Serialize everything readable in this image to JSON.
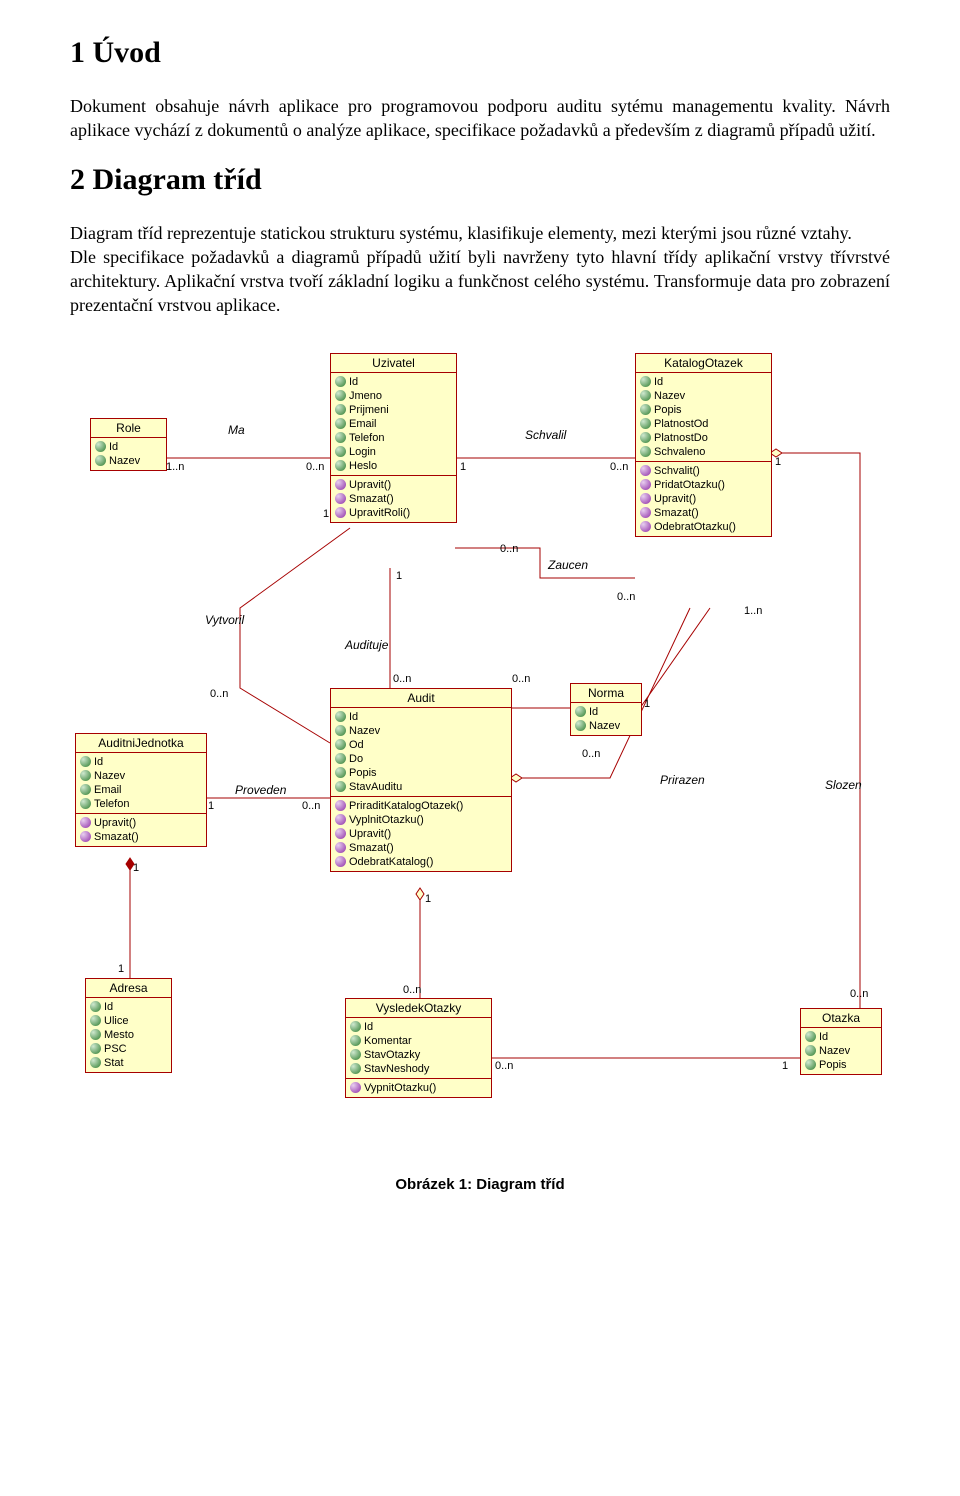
{
  "sec1": {
    "h": "1  Úvod",
    "p": "Dokument obsahuje návrh aplikace pro programovou podporu auditu sytému managementu kvality. Návrh aplikace vychází z dokumentů o analýze aplikace, specifikace požadavků a především z diagramů případů užití."
  },
  "sec2": {
    "h": "2  Diagram tříd",
    "p": "Diagram tříd reprezentuje statickou strukturu systému, klasifikuje elementy, mezi kterými jsou různé vztahy.\nDle specifikace požadavků a diagramů případů užití byli navrženy tyto hlavní třídy aplikační vrstvy třívrstvé architektury. Aplikační vrstva tvoří základní logiku a funkčnost celého systému. Transformuje data pro zobrazení prezentační vrstvou aplikace."
  },
  "caption": "Obrázek 1: Diagram tříd",
  "cls": {
    "role": {
      "name": "Role",
      "attrs": [
        "Id",
        "Nazev"
      ],
      "ops": []
    },
    "uzivatel": {
      "name": "Uzivatel",
      "attrs": [
        "Id",
        "Jmeno",
        "Prijmeni",
        "Email",
        "Telefon",
        "Login",
        "Heslo"
      ],
      "ops": [
        "Upravit()",
        "Smazat()",
        "UpravitRoli()"
      ]
    },
    "katalog": {
      "name": "KatalogOtazek",
      "attrs": [
        "Id",
        "Nazev",
        "Popis",
        "PlatnostOd",
        "PlatnostDo",
        "Schvaleno"
      ],
      "ops": [
        "Schvalit()",
        "PridatOtazku()",
        "Upravit()",
        "Smazat()",
        "OdebratOtazku()"
      ]
    },
    "auditni": {
      "name": "AuditniJednotka",
      "attrs": [
        "Id",
        "Nazev",
        "Email",
        "Telefon"
      ],
      "ops": [
        "Upravit()",
        "Smazat()"
      ]
    },
    "audit": {
      "name": "Audit",
      "attrs": [
        "Id",
        "Nazev",
        "Od",
        "Do",
        "Popis",
        "StavAuditu"
      ],
      "ops": [
        "PriraditKatalogOtazek()",
        "VyplnitOtazku()",
        "Upravit()",
        "Smazat()",
        "OdebratKatalog()"
      ]
    },
    "norma": {
      "name": "Norma",
      "attrs": [
        "Id",
        "Nazev"
      ],
      "ops": []
    },
    "adresa": {
      "name": "Adresa",
      "attrs": [
        "Id",
        "Ulice",
        "Mesto",
        "PSC",
        "Stat"
      ],
      "ops": []
    },
    "vysledek": {
      "name": "VysledekOtazky",
      "attrs": [
        "Id",
        "Komentar",
        "StavOtazky",
        "StavNeshody"
      ],
      "ops": [
        "VypnitOtazku()"
      ]
    },
    "otazka": {
      "name": "Otazka",
      "attrs": [
        "Id",
        "Nazev",
        "Popis"
      ],
      "ops": []
    }
  },
  "assoc": {
    "ma": "Ma",
    "schvalil": "Schvalil",
    "zaucen": "Zaucen",
    "vytvoril": "Vytvoril",
    "audituje": "Audituje",
    "proveden": "Proveden",
    "prirazen": "Prirazen",
    "slozen": "Slozen"
  },
  "mult": {
    "one": "1",
    "zn": "0..n",
    "on": "1..n"
  }
}
